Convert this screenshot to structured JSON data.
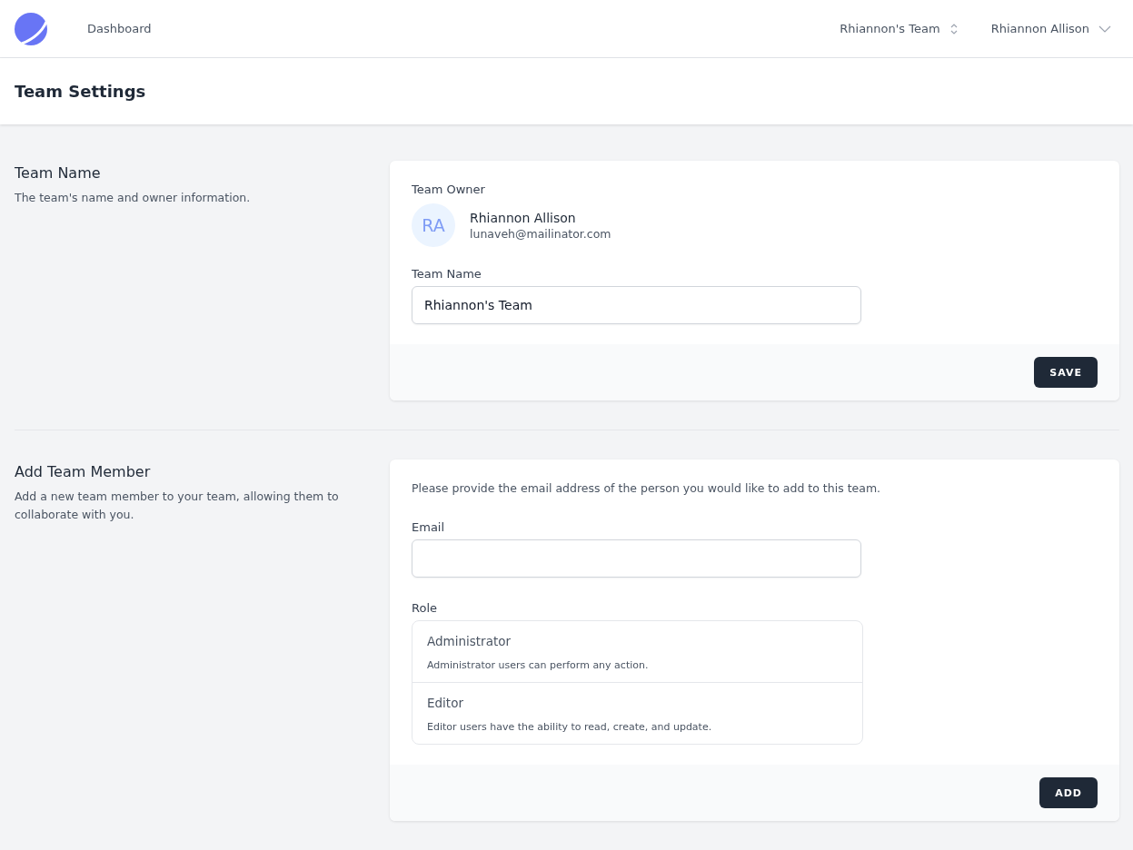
{
  "nav": {
    "links": [
      {
        "label": "Dashboard"
      }
    ],
    "team_switcher": "Rhiannon's Team",
    "user_menu": "Rhiannon Allison"
  },
  "page_title": "Team Settings",
  "team_name_section": {
    "title": "Team Name",
    "description": "The team's name and owner information.",
    "owner_label": "Team Owner",
    "owner": {
      "initials": "RA",
      "name": "Rhiannon Allison",
      "email": "lunaveh@mailinator.com"
    },
    "field_label": "Team Name",
    "field_value": "Rhiannon's Team",
    "button": "SAVE"
  },
  "add_member_section": {
    "title": "Add Team Member",
    "description": "Add a new team member to your team, allowing them to collaborate with you.",
    "intro": "Please provide the email address of the person you would like to add to this team.",
    "email_label": "Email",
    "role_label": "Role",
    "roles": [
      {
        "name": "Administrator",
        "description": "Administrator users can perform any action.",
        "selected": false
      },
      {
        "name": "Editor",
        "description": "Editor users have the ability to read, create, and update.",
        "selected": false
      }
    ],
    "button": "ADD"
  }
}
